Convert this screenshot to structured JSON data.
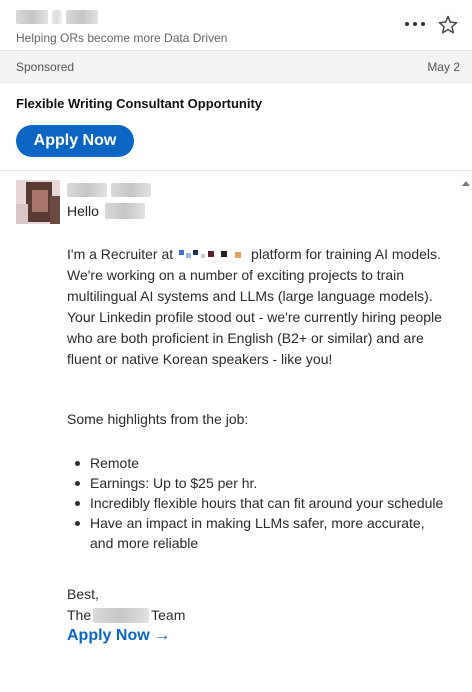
{
  "header": {
    "sender_subtitle": "Helping ORs become more Data Driven",
    "more_icon": "ellipsis-icon",
    "star_icon": "star-outline-icon"
  },
  "sponsored": {
    "label": "Sponsored",
    "date": "May 2"
  },
  "message": {
    "subject": "Flexible Writing Consultant Opportunity",
    "cta_button": "Apply Now",
    "greeting": "Hello",
    "body_before_logo": "I'm a Recruiter at",
    "body_after_logo": " platform for training AI models. We're working on a number of exciting projects to train multilingual AI systems and LLMs (large language models). Your Linkedin profile stood out - we're currently hiring people who are both proficient in English (B2+ or similar) and are fluent or native Korean speakers - like you!",
    "highlights_title": "Some highlights from the job:",
    "highlights": [
      "Remote",
      "Earnings: Up to $25 per hr.",
      "Incredibly flexible hours that can fit around your schedule",
      "Have an impact in making LLMs safer, more accurate, and more reliable"
    ],
    "signoff": "Best,",
    "team_prefix": "The",
    "team_suffix": "Team",
    "apply_link": "Apply Now →"
  },
  "colors": {
    "brand_blue": "#0a66c2",
    "sponsored_bg": "#f3f3f3"
  }
}
